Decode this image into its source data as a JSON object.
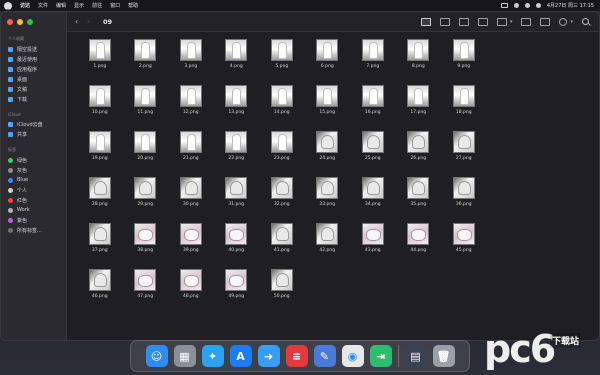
{
  "menubar": {
    "app_name": "访达",
    "menus": [
      "文件",
      "编辑",
      "显示",
      "前往",
      "窗口",
      "帮助"
    ],
    "clock": "4月27日 周三 17:15"
  },
  "sidebar": {
    "sections": [
      {
        "title": "个人收藏",
        "items": [
          {
            "label": "隔空投送",
            "icon": "airdrop-icon"
          },
          {
            "label": "最近使用",
            "icon": "clock-icon"
          },
          {
            "label": "应用程序",
            "icon": "applications-icon"
          },
          {
            "label": "桌面",
            "icon": "desktop-icon"
          },
          {
            "label": "文稿",
            "icon": "document-icon"
          },
          {
            "label": "下载",
            "icon": "download-icon"
          }
        ]
      },
      {
        "title": "iCloud",
        "items": [
          {
            "label": "iCloud云盘",
            "icon": "cloud-icon"
          },
          {
            "label": "共享",
            "icon": "shared-folder-icon"
          }
        ]
      },
      {
        "title": "标签",
        "items": [
          {
            "label": "绿色",
            "color": "#3ecf5a"
          },
          {
            "label": "灰色",
            "color": "#8e8e93"
          },
          {
            "label": "Blue",
            "color": "#3a86ff"
          },
          {
            "label": "个人",
            "color": "#d0d0d4"
          },
          {
            "label": "红色",
            "color": "#ff453a"
          },
          {
            "label": "Work",
            "color": "#b0b0b5"
          },
          {
            "label": "紫色",
            "color": "#bf5af2"
          },
          {
            "label": "所有标签...",
            "color": "#6e6e73"
          }
        ]
      }
    ]
  },
  "toolbar": {
    "back_icon": "chevron-left-icon",
    "forward_icon": "chevron-right-icon",
    "folder_title": "09",
    "view_icons": [
      "grid-view-icon",
      "list-view-icon",
      "column-view-icon",
      "gallery-view-icon",
      "group-icon",
      "share-icon",
      "tag-icon",
      "more-icon",
      "search-icon"
    ]
  },
  "files": [
    {
      "name": "1.png",
      "style": "a"
    },
    {
      "name": "2.png",
      "style": "a"
    },
    {
      "name": "3.png",
      "style": "a"
    },
    {
      "name": "4.png",
      "style": "a"
    },
    {
      "name": "5.png",
      "style": "a"
    },
    {
      "name": "6.png",
      "style": "a"
    },
    {
      "name": "7.png",
      "style": "a"
    },
    {
      "name": "8.png",
      "style": "a"
    },
    {
      "name": "9.png",
      "style": "a"
    },
    {
      "name": "10.png",
      "style": "a"
    },
    {
      "name": "11.png",
      "style": "a"
    },
    {
      "name": "12.png",
      "style": "a"
    },
    {
      "name": "13.png",
      "style": "a"
    },
    {
      "name": "14.png",
      "style": "a"
    },
    {
      "name": "15.png",
      "style": "a"
    },
    {
      "name": "16.png",
      "style": "a"
    },
    {
      "name": "17.png",
      "style": "a"
    },
    {
      "name": "18.png",
      "style": "a"
    },
    {
      "name": "19.png",
      "style": "a"
    },
    {
      "name": "20.png",
      "style": "a"
    },
    {
      "name": "21.png",
      "style": "a"
    },
    {
      "name": "22.png",
      "style": "a"
    },
    {
      "name": "23.png",
      "style": "a"
    },
    {
      "name": "24.png",
      "style": "b"
    },
    {
      "name": "25.png",
      "style": "b"
    },
    {
      "name": "26.png",
      "style": "b"
    },
    {
      "name": "27.png",
      "style": "b"
    },
    {
      "name": "28.png",
      "style": "b"
    },
    {
      "name": "29.png",
      "style": "b"
    },
    {
      "name": "30.png",
      "style": "b"
    },
    {
      "name": "31.png",
      "style": "b"
    },
    {
      "name": "32.png",
      "style": "b"
    },
    {
      "name": "33.png",
      "style": "b"
    },
    {
      "name": "34.png",
      "style": "b"
    },
    {
      "name": "35.png",
      "style": "b"
    },
    {
      "name": "36.png",
      "style": "b"
    },
    {
      "name": "37.png",
      "style": "b"
    },
    {
      "name": "38.png",
      "style": "c"
    },
    {
      "name": "39.png",
      "style": "c"
    },
    {
      "name": "40.png",
      "style": "c"
    },
    {
      "name": "41.png",
      "style": "b"
    },
    {
      "name": "42.png",
      "style": "b"
    },
    {
      "name": "43.png",
      "style": "c"
    },
    {
      "name": "44.png",
      "style": "c"
    },
    {
      "name": "45.png",
      "style": "c"
    },
    {
      "name": "46.png",
      "style": "b"
    },
    {
      "name": "47.png",
      "style": "c"
    },
    {
      "name": "48.png",
      "style": "c"
    },
    {
      "name": "49.png",
      "style": "c"
    },
    {
      "name": "50.png",
      "style": "b"
    }
  ],
  "dock": [
    {
      "name": "finder",
      "color": "#2f8cf2",
      "glyph": "☺"
    },
    {
      "name": "launchpad",
      "color": "#8a8f99",
      "glyph": "▦"
    },
    {
      "name": "safari",
      "color": "#2aa3f0",
      "glyph": "✦"
    },
    {
      "name": "app-store",
      "color": "#1c7cf2",
      "glyph": "A"
    },
    {
      "name": "migration",
      "color": "#3a9df5",
      "glyph": "➜"
    },
    {
      "name": "remote",
      "color": "#e23b3b",
      "glyph": "≡"
    },
    {
      "name": "notes",
      "color": "#4a7bd8",
      "glyph": "✎"
    },
    {
      "name": "chrome",
      "color": "#e7e7e7",
      "glyph": "◉"
    },
    {
      "name": "transfer",
      "color": "#2dbd6e",
      "glyph": "⇥"
    },
    {
      "name": "sep",
      "color": "",
      "glyph": ""
    },
    {
      "name": "downloads-stack",
      "color": "#3a4150",
      "glyph": "▤"
    },
    {
      "name": "trash",
      "color": "#9aa0a8",
      "glyph": "🗑"
    }
  ],
  "watermark": {
    "logo": "pc6",
    "sub": "下载站"
  }
}
